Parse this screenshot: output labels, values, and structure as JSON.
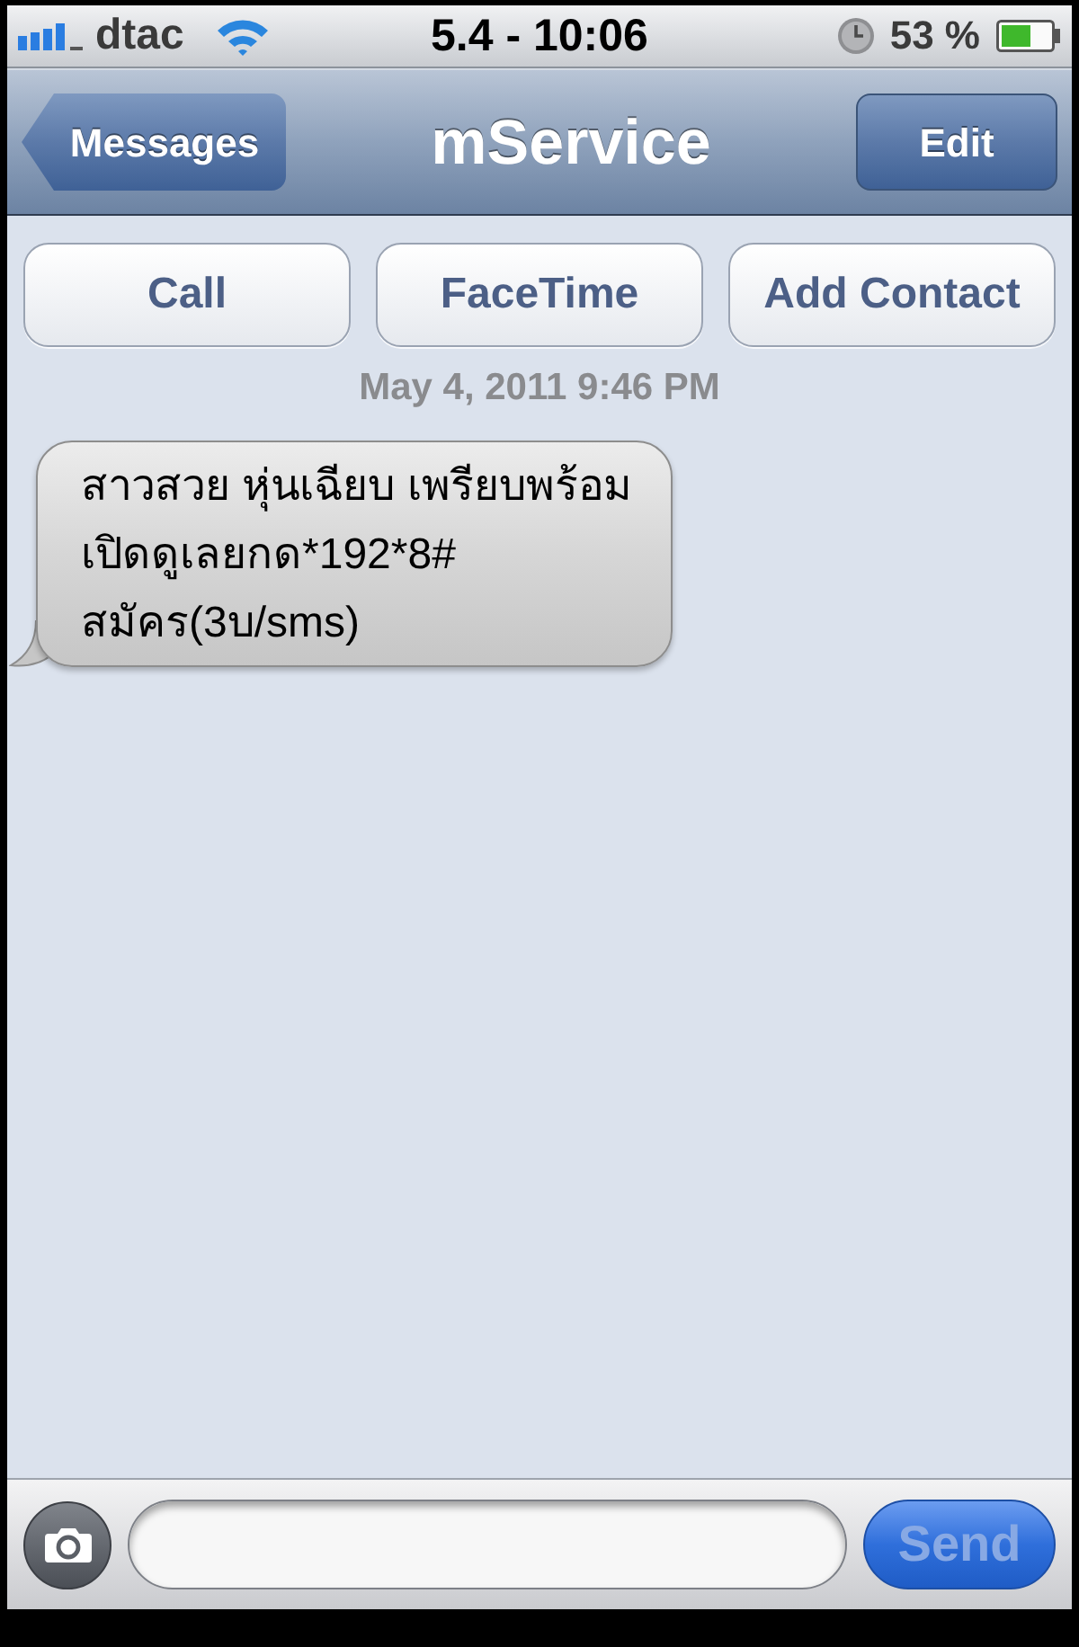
{
  "status_bar": {
    "carrier": "dtac",
    "time": "5.4 - 10:06",
    "battery": "53 %"
  },
  "nav_bar": {
    "back_button": "Messages",
    "title": "mService",
    "edit_button": "Edit"
  },
  "actions": [
    {
      "label": "Call"
    },
    {
      "label": "FaceTime"
    },
    {
      "label": "Add Contact"
    }
  ],
  "timestamp": "May 4, 2011 9:46 PM",
  "messages": [
    {
      "kind": "received",
      "text": "สาวสวย หุ่นเฉียบ เพรียบพร้อม\nเปิดดูเลยกด*192*8#\nสมัคร(3บ/sms)"
    }
  ],
  "composer": {
    "send_button": {
      "label": "Send",
      "disabled": true
    }
  }
}
